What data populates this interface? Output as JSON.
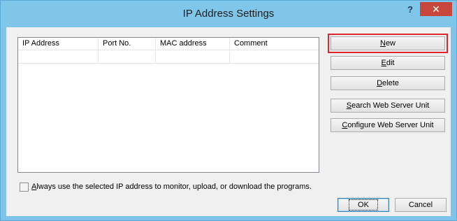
{
  "window": {
    "title": "IP Address Settings",
    "help_label": "?",
    "close_label": "✕"
  },
  "table": {
    "columns": [
      "IP Address",
      "Port No.",
      "MAC address",
      "Comment"
    ],
    "rows": [
      [
        "",
        "",
        "",
        ""
      ]
    ]
  },
  "buttons": {
    "new": {
      "accel": "N",
      "rest": "ew"
    },
    "edit": {
      "accel": "E",
      "rest": "dit"
    },
    "delete": {
      "accel": "D",
      "rest": "elete"
    },
    "search": {
      "accel": "S",
      "rest": "earch Web Server Unit"
    },
    "configure": {
      "accel": "C",
      "rest": "onfigure Web Server Unit"
    },
    "ok": "OK",
    "cancel": "Cancel"
  },
  "checkbox": {
    "accel": "A",
    "rest": "lways use the selected IP address to monitor, upload, or download the programs.",
    "checked": false
  },
  "colors": {
    "highlight": "#e0252c",
    "titlebar": "#80c6ea",
    "close": "#c7473d"
  }
}
